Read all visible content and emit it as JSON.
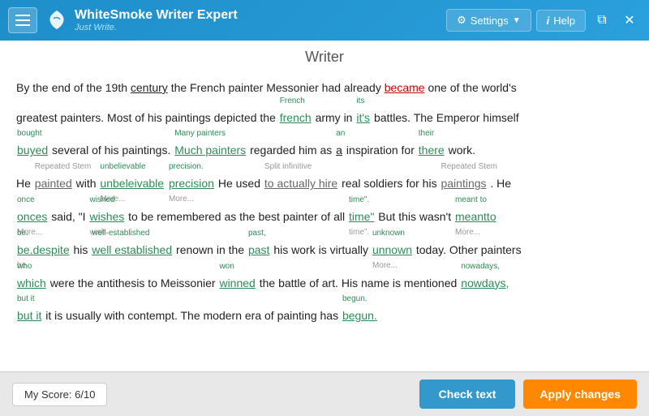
{
  "titlebar": {
    "app_name": "WhiteSmoke Writer Expert",
    "subtitle": "Just Write.",
    "settings_label": "Settings",
    "help_label": "Help"
  },
  "main": {
    "title": "Writer"
  },
  "bottombar": {
    "score_label": "My Score: 6/10",
    "check_label": "Check text",
    "apply_label": "Apply changes"
  }
}
